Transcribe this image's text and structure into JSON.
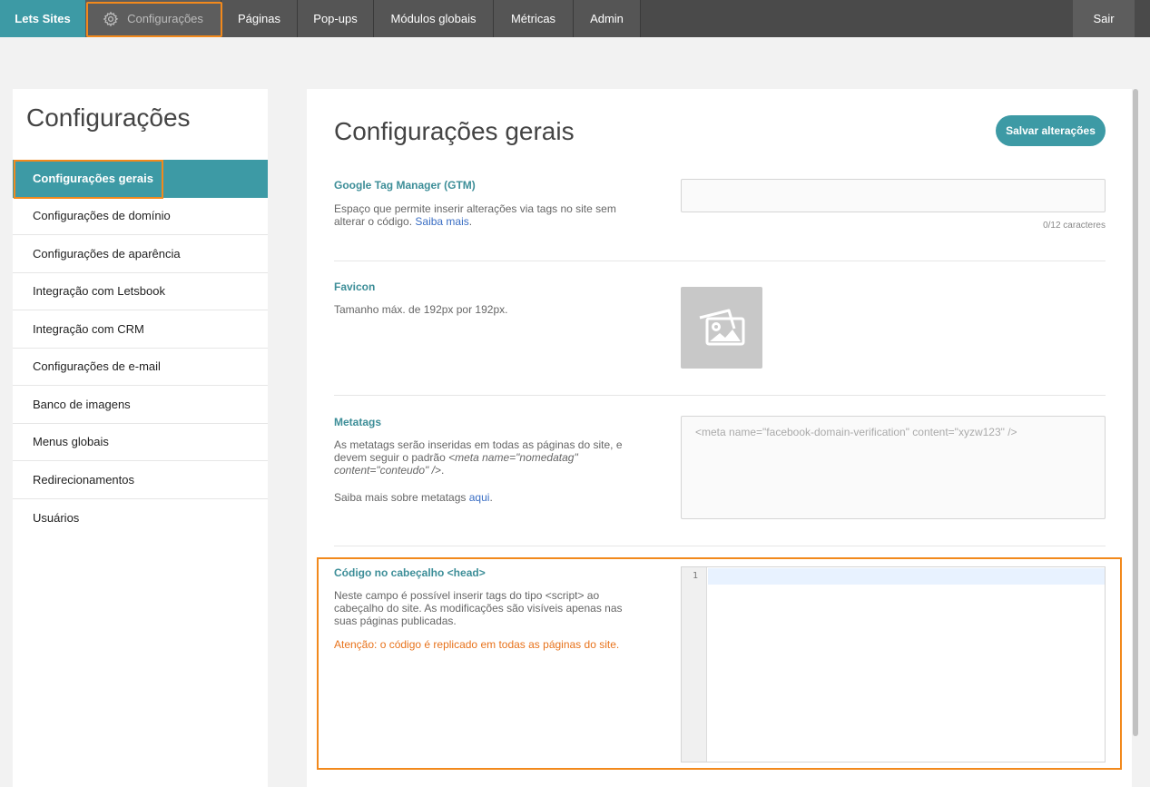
{
  "topbar": {
    "brand": "Lets Sites",
    "items": [
      "Configurações",
      "Páginas",
      "Pop-ups",
      "Módulos globais",
      "Métricas",
      "Admin"
    ],
    "logout": "Sair"
  },
  "sidebar": {
    "title": "Configurações",
    "items": [
      {
        "label": "Configurações gerais"
      },
      {
        "label": "Configurações de domínio"
      },
      {
        "label": "Configurações de aparência"
      },
      {
        "label": "Integração com Letsbook"
      },
      {
        "label": "Integração com CRM"
      },
      {
        "label": "Configurações de e-mail"
      },
      {
        "label": "Banco de imagens"
      },
      {
        "label": "Menus globais"
      },
      {
        "label": "Redirecionamentos"
      },
      {
        "label": "Usuários"
      }
    ]
  },
  "main": {
    "title": "Configurações gerais",
    "save_label": "Salvar alterações",
    "gtm": {
      "label": "Google Tag Manager (GTM)",
      "desc": "Espaço que permite inserir alterações via tags no site sem alterar o código.",
      "link": "Saiba mais",
      "value": "",
      "counter": "0/12 caracteres"
    },
    "favicon": {
      "label": "Favicon",
      "desc": "Tamanho máx. de 192px por 192px.",
      "icon": "image-icon"
    },
    "metatags": {
      "label": "Metatags",
      "desc1": "As metatags serão inseridas em todas as páginas do site, e devem seguir o padrão",
      "desc_code": "<meta name=\"nomedatag\" content=\"conteudo\" />",
      "desc_more": "Saiba mais sobre metatags",
      "link": "aqui",
      "placeholder": "<meta name=\"facebook-domain-verification\" content=\"xyzw123\" />"
    },
    "head_code": {
      "label": "Código no cabeçalho <head>",
      "desc": "Neste campo é possível inserir tags do tipo <script> ao cabeçalho do site. As modificações são visíveis apenas nas suas páginas publicadas.",
      "warning": "Atenção: o código é replicado em todas as páginas do site.",
      "line_number": "1"
    }
  },
  "colors": {
    "accent": "#3d9aa5",
    "highlight": "#f2891c",
    "topbar": "#4a4a4a",
    "warning": "#e8731c"
  }
}
